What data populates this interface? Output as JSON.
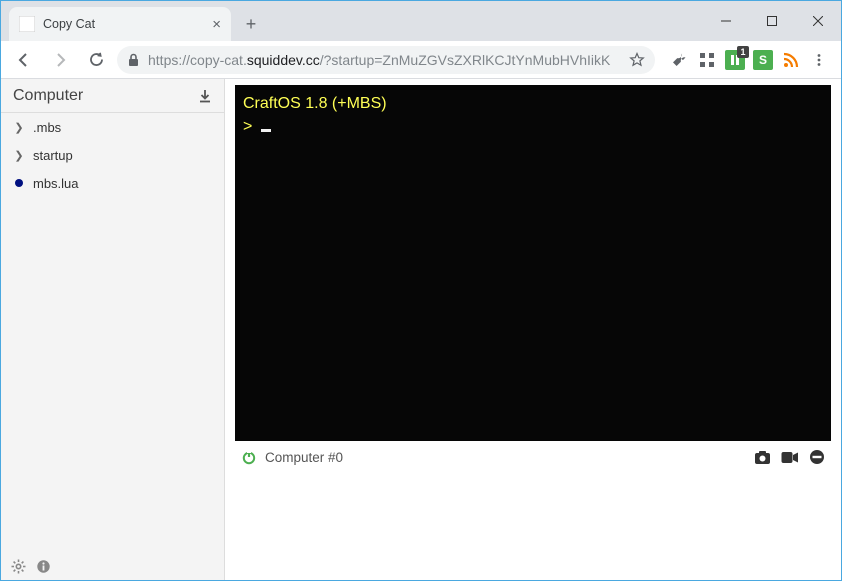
{
  "window": {
    "tab_title": "Copy Cat",
    "ext_badge": "1"
  },
  "toolbar": {
    "url_proto": "https://",
    "url_sub": "copy-cat.",
    "url_domain": "squiddev.cc",
    "url_path": "/?startup=ZnMuZGVsZXRlKCJtYnMubHVhIikK"
  },
  "sidebar": {
    "title": "Computer",
    "items": [
      {
        "kind": "folder",
        "label": ".mbs"
      },
      {
        "kind": "folder",
        "label": "startup"
      },
      {
        "kind": "lua",
        "label": "mbs.lua"
      }
    ]
  },
  "terminal": {
    "line1": "CraftOS 1.8 (+MBS)",
    "line2": "> "
  },
  "statusbar": {
    "label": "Computer #0"
  }
}
